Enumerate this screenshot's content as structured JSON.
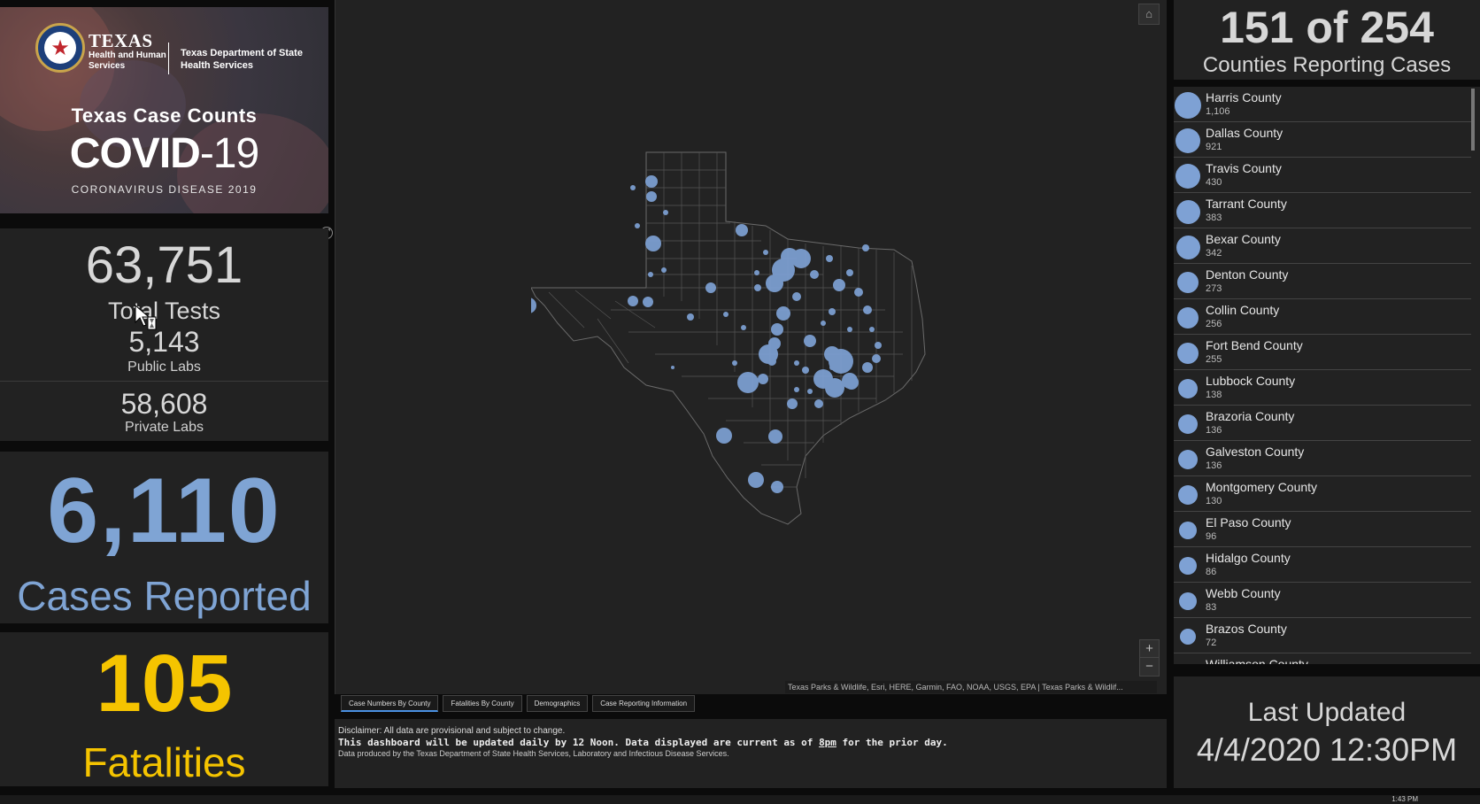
{
  "header": {
    "org_texas": "TEXAS",
    "org_hhs": "Health and Human Services",
    "org_dshs": "Texas Department of State Health Services",
    "subtitle": "Texas Case Counts",
    "title_main": "COVID",
    "title_suffix": "-19",
    "tagline": "CORONAVIRUS DISEASE 2019"
  },
  "tests": {
    "total": "63,751",
    "total_label": "Total Tests",
    "public": "5,143",
    "public_label": "Public Labs",
    "private": "58,608",
    "private_label": "Private Labs"
  },
  "cases": {
    "value": "6,110",
    "label": "Cases Reported",
    "color": "#7fa4d4"
  },
  "fatalities": {
    "value": "105",
    "label": "Fatalities",
    "color": "#f5c400"
  },
  "counties_reporting": {
    "value": "151 of 254",
    "label": "Counties Reporting Cases"
  },
  "county_list": [
    {
      "name": "Harris County",
      "value": "1,106"
    },
    {
      "name": "Dallas County",
      "value": "921"
    },
    {
      "name": "Travis County",
      "value": "430"
    },
    {
      "name": "Tarrant County",
      "value": "383"
    },
    {
      "name": "Bexar County",
      "value": "342"
    },
    {
      "name": "Denton County",
      "value": "273"
    },
    {
      "name": "Collin County",
      "value": "256"
    },
    {
      "name": "Fort Bend County",
      "value": "255"
    },
    {
      "name": "Lubbock County",
      "value": "138"
    },
    {
      "name": "Brazoria County",
      "value": "136"
    },
    {
      "name": "Galveston County",
      "value": "136"
    },
    {
      "name": "Montgomery County",
      "value": "130"
    },
    {
      "name": "El Paso County",
      "value": "96"
    },
    {
      "name": "Hidalgo County",
      "value": "86"
    },
    {
      "name": "Webb County",
      "value": "83"
    },
    {
      "name": "Brazos County",
      "value": "72"
    },
    {
      "name": "Williamson County",
      "value": ""
    }
  ],
  "updated": {
    "label": "Last Updated",
    "value": "4/4/2020 12:30PM"
  },
  "map": {
    "attribution": "Texas Parks & Wildlife, Esri, HERE, Garmin, FAO, NOAA, USGS, EPA | Texas Parks & Wildlif...",
    "zoom_in": "+",
    "zoom_out": "−",
    "home": "⌂"
  },
  "tabs": [
    {
      "label": "Case Numbers By County"
    },
    {
      "label": "Fatalities By County"
    },
    {
      "label": "Demographics"
    },
    {
      "label": "Case Reporting Information"
    }
  ],
  "disclaimer": {
    "line1": "Disclaimer: All data are provisional and subject to change.",
    "line2_pre": "This dashboard will be updated daily by 12 Noon. Data displayed are current as of ",
    "line2_time": "8pm",
    "line2_post": " for the prior day.",
    "line3": "Data produced by the Texas Department of State Health Services, Laboratory and Infectious Disease Services."
  },
  "taskbar": {
    "time": "1:43 PM"
  },
  "icons": {
    "expand": "expand-icon",
    "home": "home-icon",
    "cursor": "cursor-icon"
  }
}
